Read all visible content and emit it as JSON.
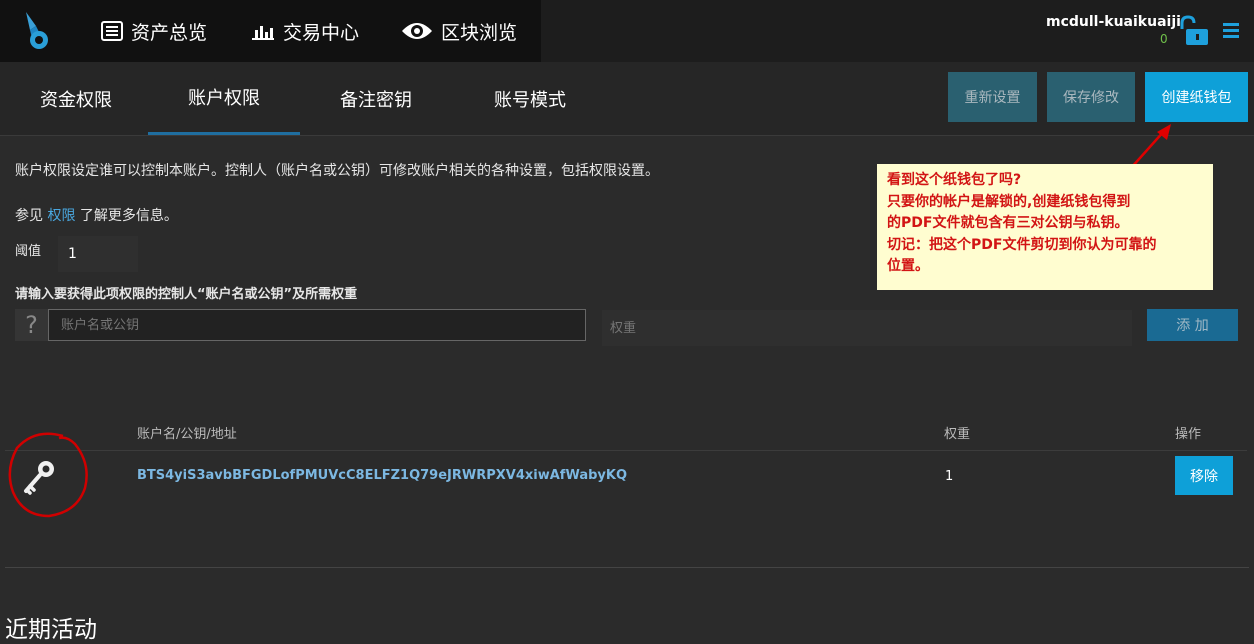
{
  "header": {
    "nav": [
      {
        "label": "资产总览",
        "icon": "document-list-icon"
      },
      {
        "label": "交易中心",
        "icon": "bar-chart-icon"
      },
      {
        "label": "区块浏览",
        "icon": "eye-icon"
      }
    ],
    "user": "mcdull-kuaikuaiji",
    "balance": "0"
  },
  "tabs": [
    "资金权限",
    "账户权限",
    "备注密钥",
    "账号模式"
  ],
  "actions": {
    "reset": "重新设置",
    "save": "保存修改",
    "create_wallet": "创建纸钱包"
  },
  "content": {
    "description": "账户权限设定谁可以控制本账户。控制人（账户名或公钥）可修改账户相关的各种设置，包括权限设置。",
    "see_prefix": "参见 ",
    "see_link": "权限",
    "see_suffix": " 了解更多信息。",
    "threshold_label": "阈值",
    "threshold_value": "1",
    "prompt": "请输入要获得此项权限的控制人“账户名或公钥”及所需权重",
    "unknown_mark": "?",
    "account_placeholder": "账户名或公钥",
    "weight_placeholder": "权重",
    "add_label": "添 加"
  },
  "table": {
    "headers": {
      "name": "账户名/公钥/地址",
      "weight": "权重",
      "action": "操作"
    },
    "rows": [
      {
        "key": "BTS4yiS3avbBFGDLofPMUVcC8ELFZ1Q79eJRWRPXV4xiwAfWabyKQ",
        "weight": "1",
        "action": "移除"
      }
    ]
  },
  "note": {
    "lines": [
      "看到这个纸钱包了吗?",
      "只要你的帐户是解锁的,创建纸钱包得到",
      "的PDF文件就包含有三对公钥与私钥。",
      "切记：把这个PDF文件剪切到你认为可靠的",
      "位置。"
    ]
  },
  "recent_title": "近期活动",
  "colors": {
    "accent": "#0ea0d8",
    "link": "#4aa8e0",
    "note_bg": "#fffdd0",
    "note_text": "#d21414",
    "annotation": "#e00000"
  }
}
